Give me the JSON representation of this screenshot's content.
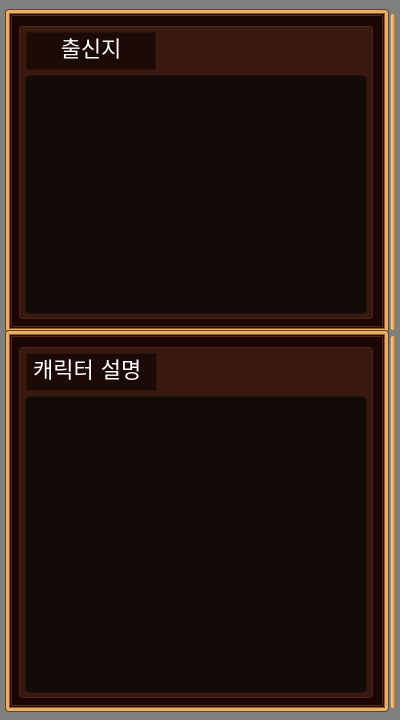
{
  "panels": {
    "origin": {
      "title": "출신지",
      "body": ""
    },
    "description": {
      "title": "캐릭터 설명",
      "body": ""
    }
  },
  "colors": {
    "background": "#7f7f7f",
    "frame_gold": "#e6b06a",
    "panel_dark": "#1b0505",
    "inner_brown": "#3a1a10",
    "content_black": "#120b08",
    "title_text": "#ffffff"
  }
}
